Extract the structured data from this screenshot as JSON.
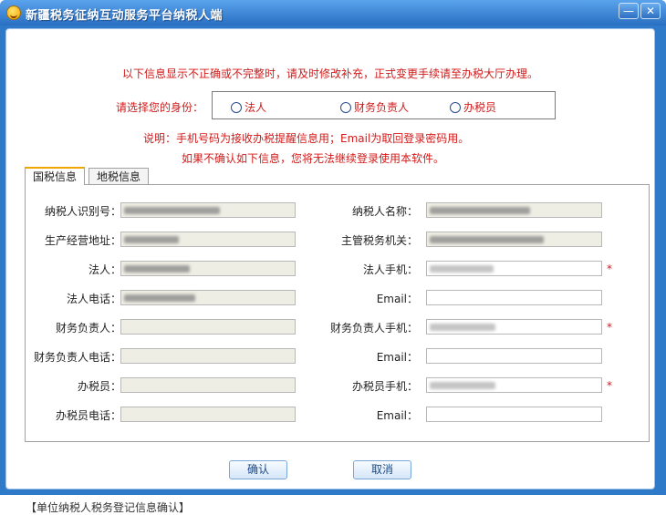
{
  "window": {
    "title": "新疆税务征纳互动服务平台纳税人端",
    "minimize_label": "—",
    "close_label": "✕"
  },
  "notice": "以下信息显示不正确或不完整时，请及时修改补充，正式变更手续请至办税大厅办理。",
  "identity": {
    "label": "请选择您的身份：",
    "options": [
      "法人",
      "财务负责人",
      "办税员"
    ]
  },
  "notes": {
    "line1": "说明：手机号码为接收办税提醒信息用；Email为取回登录密码用。",
    "line2": "如果不确认如下信息，您将无法继续登录使用本软件。"
  },
  "tabs": [
    "国税信息",
    "地税信息"
  ],
  "form": {
    "left": [
      {
        "label": "纳税人识别号：",
        "value": "",
        "readonly": true,
        "blurred": true
      },
      {
        "label": "生产经营地址：",
        "value": "",
        "readonly": true,
        "blurred": true
      },
      {
        "label": "法人：",
        "value": "",
        "readonly": true,
        "blurred": true
      },
      {
        "label": "法人电话：",
        "value": "",
        "readonly": true,
        "blurred": true
      },
      {
        "label": "财务负责人：",
        "value": "",
        "readonly": true,
        "blurred": false
      },
      {
        "label": "财务负责人电话：",
        "value": "",
        "readonly": true,
        "blurred": false
      },
      {
        "label": "办税员：",
        "value": "",
        "readonly": true,
        "blurred": false
      },
      {
        "label": "办税员电话：",
        "value": "",
        "readonly": true,
        "blurred": false
      }
    ],
    "right": [
      {
        "label": "纳税人名称：",
        "value": "",
        "readonly": true,
        "blurred": true,
        "required": false
      },
      {
        "label": "主管税务机关：",
        "value": "",
        "readonly": true,
        "blurred": true,
        "required": false
      },
      {
        "label": "法人手机：",
        "value": "",
        "readonly": false,
        "blurred": true,
        "required": true
      },
      {
        "label": "Email：",
        "value": "",
        "readonly": false,
        "blurred": false,
        "required": false
      },
      {
        "label": "财务负责人手机：",
        "value": "",
        "readonly": false,
        "blurred": true,
        "required": true
      },
      {
        "label": "Email：",
        "value": "",
        "readonly": false,
        "blurred": false,
        "required": false
      },
      {
        "label": "办税员手机：",
        "value": "",
        "readonly": false,
        "blurred": true,
        "required": true
      },
      {
        "label": "Email：",
        "value": "",
        "readonly": false,
        "blurred": false,
        "required": false
      }
    ],
    "required_mark": "*"
  },
  "buttons": {
    "confirm": "确认",
    "cancel": "取消"
  },
  "footer": "【单位纳税人税务登记信息确认】"
}
